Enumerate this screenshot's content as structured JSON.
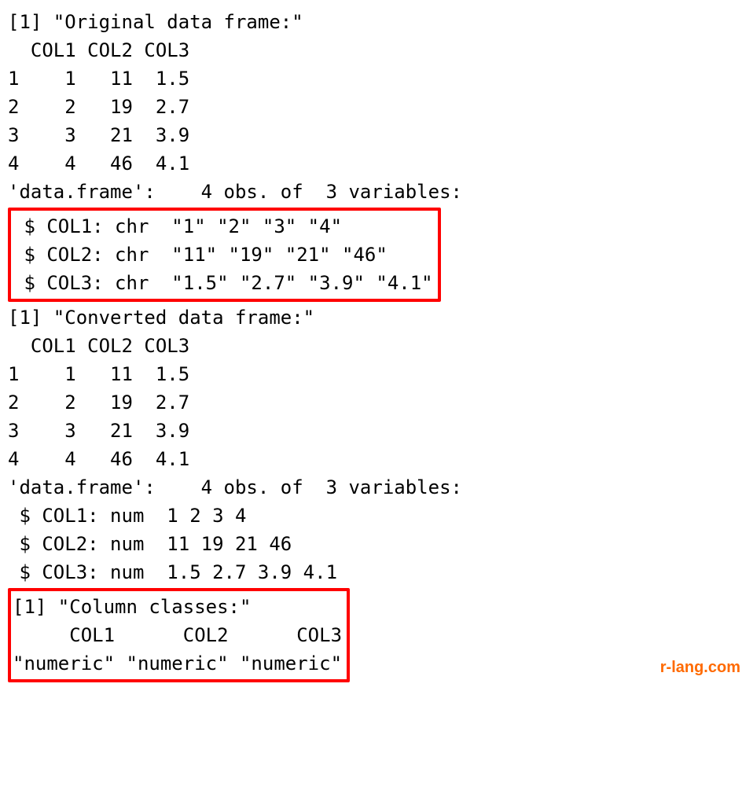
{
  "lines": {
    "orig_title": "[1] \"Original data frame:\"",
    "header1": "  COL1 COL2 COL3",
    "row1_1": "1    1   11  1.5",
    "row1_2": "2    2   19  2.7",
    "row1_3": "3    3   21  3.9",
    "row1_4": "4    4   46  4.1",
    "str_header1": "'data.frame':    4 obs. of  3 variables:",
    "str1_col1": " $ COL1: chr  \"1\" \"2\" \"3\" \"4\"",
    "str1_col2": " $ COL2: chr  \"11\" \"19\" \"21\" \"46\"",
    "str1_col3": " $ COL3: chr  \"1.5\" \"2.7\" \"3.9\" \"4.1\"",
    "conv_title": "[1] \"Converted data frame:\"",
    "header2": "  COL1 COL2 COL3",
    "row2_1": "1    1   11  1.5",
    "row2_2": "2    2   19  2.7",
    "row2_3": "3    3   21  3.9",
    "row2_4": "4    4   46  4.1",
    "str_header2": "'data.frame':    4 obs. of  3 variables:",
    "str2_col1": " $ COL1: num  1 2 3 4",
    "str2_col2": " $ COL2: num  11 19 21 46",
    "str2_col3": " $ COL3: num  1.5 2.7 3.9 4.1",
    "classes_title": "[1] \"Column classes:\"",
    "classes_hdr": "     COL1      COL2      COL3",
    "classes_val": "\"numeric\" \"numeric\" \"numeric\""
  },
  "watermark": "r-lang.com"
}
